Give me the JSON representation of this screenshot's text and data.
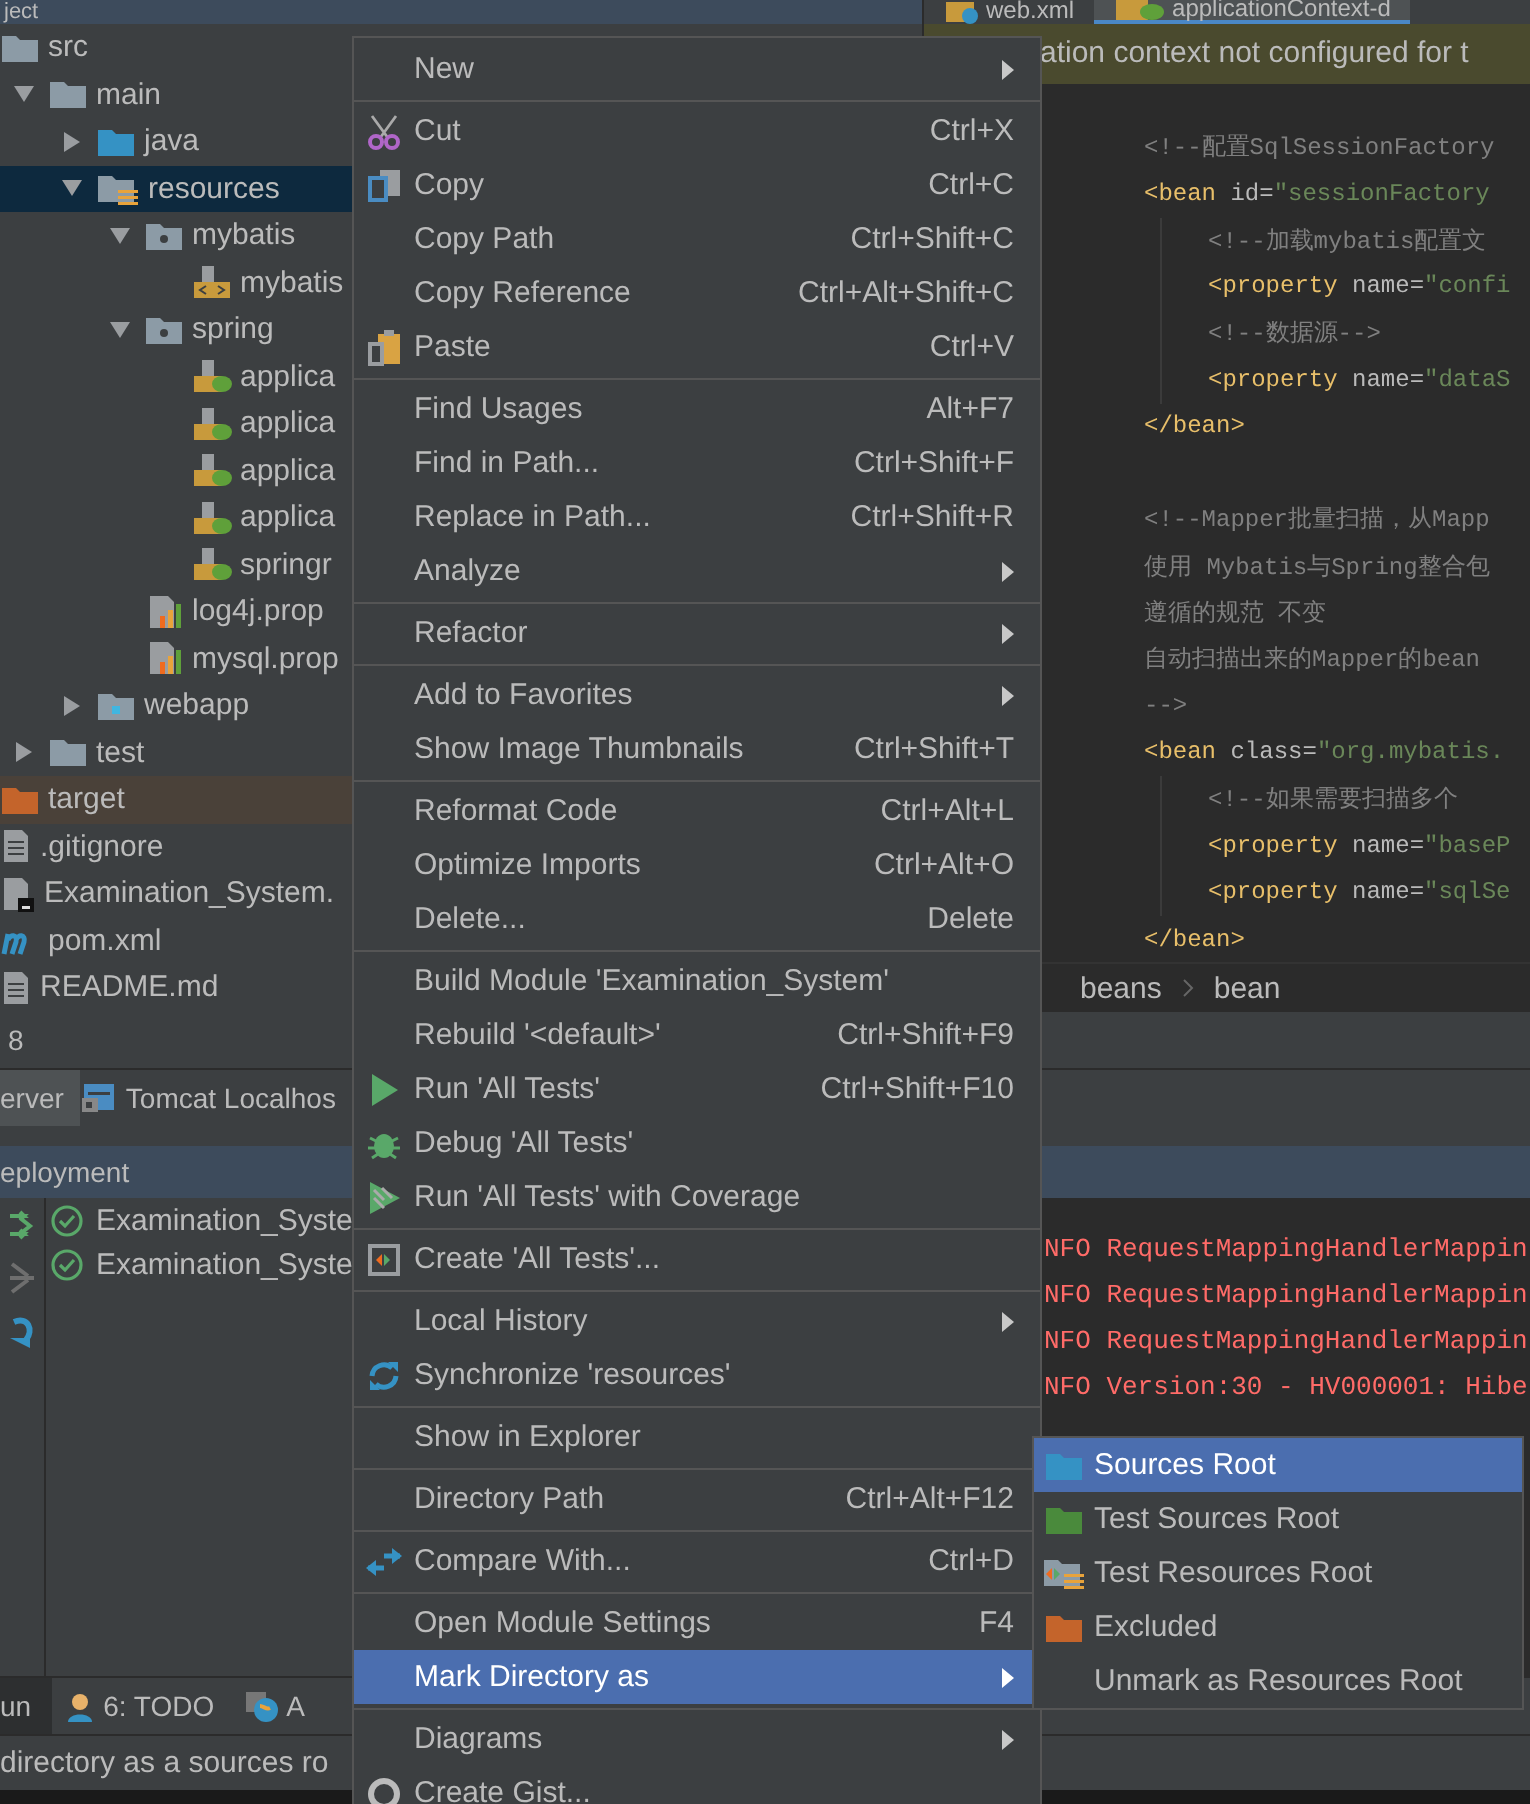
{
  "project_panel": {
    "title": "ject"
  },
  "tree": [
    {
      "label": "src",
      "kind": "folder",
      "selected": false,
      "children": [
        {
          "label": "main",
          "kind": "folder",
          "expanded": true,
          "selected": false,
          "children": [
            {
              "label": "java",
              "kind": "source-folder",
              "expanded": false,
              "selected": false
            },
            {
              "label": "resources",
              "kind": "resource-folder",
              "expanded": true,
              "selected": true,
              "children": [
                {
                  "label": "mybatis",
                  "kind": "package",
                  "expanded": true,
                  "selected": false,
                  "children": [
                    {
                      "label": "mybatis",
                      "kind": "xml",
                      "selected": false
                    }
                  ]
                },
                {
                  "label": "spring",
                  "kind": "package",
                  "expanded": true,
                  "selected": false,
                  "children": [
                    {
                      "label": "applica",
                      "kind": "spring-xml",
                      "selected": false
                    },
                    {
                      "label": "applica",
                      "kind": "spring-xml",
                      "selected": false
                    },
                    {
                      "label": "applica",
                      "kind": "spring-xml",
                      "selected": false
                    },
                    {
                      "label": "applica",
                      "kind": "spring-xml",
                      "selected": false
                    },
                    {
                      "label": "springr",
                      "kind": "spring-xml",
                      "selected": false
                    }
                  ]
                },
                {
                  "label": "log4j.prop",
                  "kind": "properties",
                  "selected": false
                },
                {
                  "label": "mysql.prop",
                  "kind": "properties",
                  "selected": false
                }
              ]
            },
            {
              "label": "webapp",
              "kind": "web-folder",
              "expanded": false,
              "selected": false
            }
          ]
        },
        {
          "label": "test",
          "kind": "folder",
          "expanded": false,
          "selected": false
        }
      ]
    },
    {
      "label": "target",
      "kind": "excluded-folder",
      "selected": false
    },
    {
      "label": ".gitignore",
      "kind": "text",
      "selected": false
    },
    {
      "label": "Examination_System.",
      "kind": "module",
      "selected": false
    },
    {
      "label": "pom.xml",
      "kind": "maven",
      "selected": false
    },
    {
      "label": "README.md",
      "kind": "text",
      "selected": false
    }
  ],
  "editor": {
    "tabs": [
      {
        "label": "web.xml",
        "kind": "web",
        "selected": false
      },
      {
        "label": "applicationContext-d",
        "kind": "spring",
        "selected": true
      }
    ],
    "banner": "ation context not configured for t",
    "lines": [
      {
        "segments": [
          {
            "kind": "comment",
            "text": "<!--配置SqlSessionFactory"
          }
        ]
      },
      {
        "segments": [
          {
            "kind": "tag",
            "text": "<bean"
          },
          {
            "kind": "attr",
            "text": " id="
          },
          {
            "kind": "value",
            "text": "\"sessionFactory"
          }
        ],
        "children": [
          {
            "segments": [
              {
                "kind": "comment",
                "text": "<!--加载mybatis配置文"
              }
            ]
          },
          {
            "segments": [
              {
                "kind": "tag",
                "text": "<property"
              },
              {
                "kind": "attr",
                "text": " name="
              },
              {
                "kind": "value",
                "text": "\"confi"
              }
            ]
          },
          {
            "segments": [
              {
                "kind": "comment",
                "text": "<!--数据源-->"
              }
            ]
          },
          {
            "segments": [
              {
                "kind": "tag",
                "text": "<property"
              },
              {
                "kind": "attr",
                "text": " name="
              },
              {
                "kind": "value",
                "text": "\"dataS"
              }
            ]
          }
        ]
      },
      {
        "segments": [
          {
            "kind": "tag",
            "text": "</bean>"
          }
        ]
      },
      {
        "gap_before": true,
        "segments": [
          {
            "kind": "comment",
            "text": "<!--Mapper批量扫描，从Mapp"
          }
        ]
      },
      {
        "segments": [
          {
            "kind": "comment",
            "text": "使用 Mybatis与Spring整合包"
          }
        ]
      },
      {
        "segments": [
          {
            "kind": "comment",
            "text": "遵循的规范 不变"
          }
        ]
      },
      {
        "segments": [
          {
            "kind": "comment",
            "text": "自动扫描出来的Mapper的bean"
          }
        ]
      },
      {
        "segments": [
          {
            "kind": "comment",
            "text": "-->"
          }
        ]
      },
      {
        "segments": [
          {
            "kind": "tag",
            "text": "<bean"
          },
          {
            "kind": "attr",
            "text": " class="
          },
          {
            "kind": "value",
            "text": "\"org.mybatis."
          }
        ],
        "children": [
          {
            "segments": [
              {
                "kind": "comment",
                "text": "<!--如果需要扫描多个"
              }
            ]
          },
          {
            "segments": [
              {
                "kind": "tag",
                "text": "<property"
              },
              {
                "kind": "attr",
                "text": " name="
              },
              {
                "kind": "value",
                "text": "\"baseP"
              }
            ]
          },
          {
            "segments": [
              {
                "kind": "tag",
                "text": "<property"
              },
              {
                "kind": "attr",
                "text": " name="
              },
              {
                "kind": "value",
                "text": "\"sqlSe"
              }
            ]
          }
        ]
      },
      {
        "segments": [
          {
            "kind": "tag",
            "text": "</bean>"
          }
        ]
      }
    ],
    "breadcrumbs": [
      "beans",
      "bean"
    ]
  },
  "bottom": {
    "number": "8",
    "tool_tabs": [
      {
        "label": "erver",
        "kind": "plain",
        "selected": true
      },
      {
        "label": "Tomcat Localhos",
        "kind": "tomcat",
        "selected": false
      }
    ],
    "deployment_header": "eployment",
    "deployments": [
      {
        "label": "Examination_Syste"
      },
      {
        "label": "Examination_Syste"
      }
    ],
    "console": [
      "NFO RequestMappingHandlerMappin",
      "NFO RequestMappingHandlerMappin",
      "NFO RequestMappingHandlerMappin",
      "NFO Version:30 - HV000001: Hibe"
    ],
    "tool_strip": [
      {
        "label": "un",
        "kind": "plain",
        "selected": true
      },
      {
        "label": "6: TODO",
        "kind": "todo",
        "selected": false
      },
      {
        "label": "A",
        "kind": "globe",
        "selected": false
      }
    ],
    "status": "directory as a sources ro"
  },
  "context_menu": [
    {
      "kind": "item",
      "label": "New",
      "submenu": true,
      "selected": false
    },
    {
      "kind": "separator"
    },
    {
      "kind": "item",
      "label": "Cut",
      "shortcut": "Ctrl+X",
      "selected": false
    },
    {
      "kind": "item",
      "label": "Copy",
      "shortcut": "Ctrl+C",
      "selected": false
    },
    {
      "kind": "item",
      "label": "Copy Path",
      "shortcut": "Ctrl+Shift+C",
      "selected": false
    },
    {
      "kind": "item",
      "label": "Copy Reference",
      "shortcut": "Ctrl+Alt+Shift+C",
      "selected": false
    },
    {
      "kind": "item",
      "label": "Paste",
      "shortcut": "Ctrl+V",
      "selected": false
    },
    {
      "kind": "separator"
    },
    {
      "kind": "item",
      "label": "Find Usages",
      "shortcut": "Alt+F7",
      "selected": false
    },
    {
      "kind": "item",
      "label": "Find in Path...",
      "shortcut": "Ctrl+Shift+F",
      "selected": false
    },
    {
      "kind": "item",
      "label": "Replace in Path...",
      "shortcut": "Ctrl+Shift+R",
      "selected": false
    },
    {
      "kind": "item",
      "label": "Analyze",
      "submenu": true,
      "selected": false
    },
    {
      "kind": "separator"
    },
    {
      "kind": "item",
      "label": "Refactor",
      "submenu": true,
      "selected": false
    },
    {
      "kind": "separator"
    },
    {
      "kind": "item",
      "label": "Add to Favorites",
      "submenu": true,
      "selected": false
    },
    {
      "kind": "item",
      "label": "Show Image Thumbnails",
      "shortcut": "Ctrl+Shift+T",
      "selected": false
    },
    {
      "kind": "separator"
    },
    {
      "kind": "item",
      "label": "Reformat Code",
      "shortcut": "Ctrl+Alt+L",
      "selected": false
    },
    {
      "kind": "item",
      "label": "Optimize Imports",
      "shortcut": "Ctrl+Alt+O",
      "selected": false
    },
    {
      "kind": "item",
      "label": "Delete...",
      "shortcut": "Delete",
      "selected": false
    },
    {
      "kind": "separator"
    },
    {
      "kind": "item",
      "label": "Build Module 'Examination_System'",
      "selected": false
    },
    {
      "kind": "item",
      "label": "Rebuild '<default>'",
      "shortcut": "Ctrl+Shift+F9",
      "selected": false
    },
    {
      "kind": "item",
      "label": "Run 'All Tests'",
      "shortcut": "Ctrl+Shift+F10",
      "selected": false
    },
    {
      "kind": "item",
      "label": "Debug 'All Tests'",
      "selected": false
    },
    {
      "kind": "item",
      "label": "Run 'All Tests' with Coverage",
      "selected": false
    },
    {
      "kind": "separator"
    },
    {
      "kind": "item",
      "label": "Create 'All Tests'...",
      "selected": false
    },
    {
      "kind": "separator"
    },
    {
      "kind": "item",
      "label": "Local History",
      "submenu": true,
      "selected": false
    },
    {
      "kind": "item",
      "label": "Synchronize 'resources'",
      "selected": false
    },
    {
      "kind": "separator"
    },
    {
      "kind": "item",
      "label": "Show in Explorer",
      "selected": false
    },
    {
      "kind": "separator"
    },
    {
      "kind": "item",
      "label": "Directory Path",
      "shortcut": "Ctrl+Alt+F12",
      "selected": false
    },
    {
      "kind": "separator"
    },
    {
      "kind": "item",
      "label": "Compare With...",
      "shortcut": "Ctrl+D",
      "selected": false
    },
    {
      "kind": "separator"
    },
    {
      "kind": "item",
      "label": "Open Module Settings",
      "shortcut": "F4",
      "selected": false
    },
    {
      "kind": "item",
      "label": "Mark Directory as",
      "submenu": true,
      "selected": true
    },
    {
      "kind": "separator"
    },
    {
      "kind": "item",
      "label": "Diagrams",
      "submenu": true,
      "selected": false
    },
    {
      "kind": "item",
      "label": "Create Gist...",
      "selected": false
    }
  ],
  "submenu": [
    {
      "kind": "source",
      "label": "Sources Root",
      "selected": true
    },
    {
      "kind": "test",
      "label": "Test Sources Root",
      "selected": false
    },
    {
      "kind": "resource",
      "label": "Test Resources Root",
      "selected": false
    },
    {
      "kind": "excluded",
      "label": "Excluded",
      "selected": false
    },
    {
      "kind": "plain",
      "label": "Unmark as Resources Root",
      "selected": false
    }
  ]
}
